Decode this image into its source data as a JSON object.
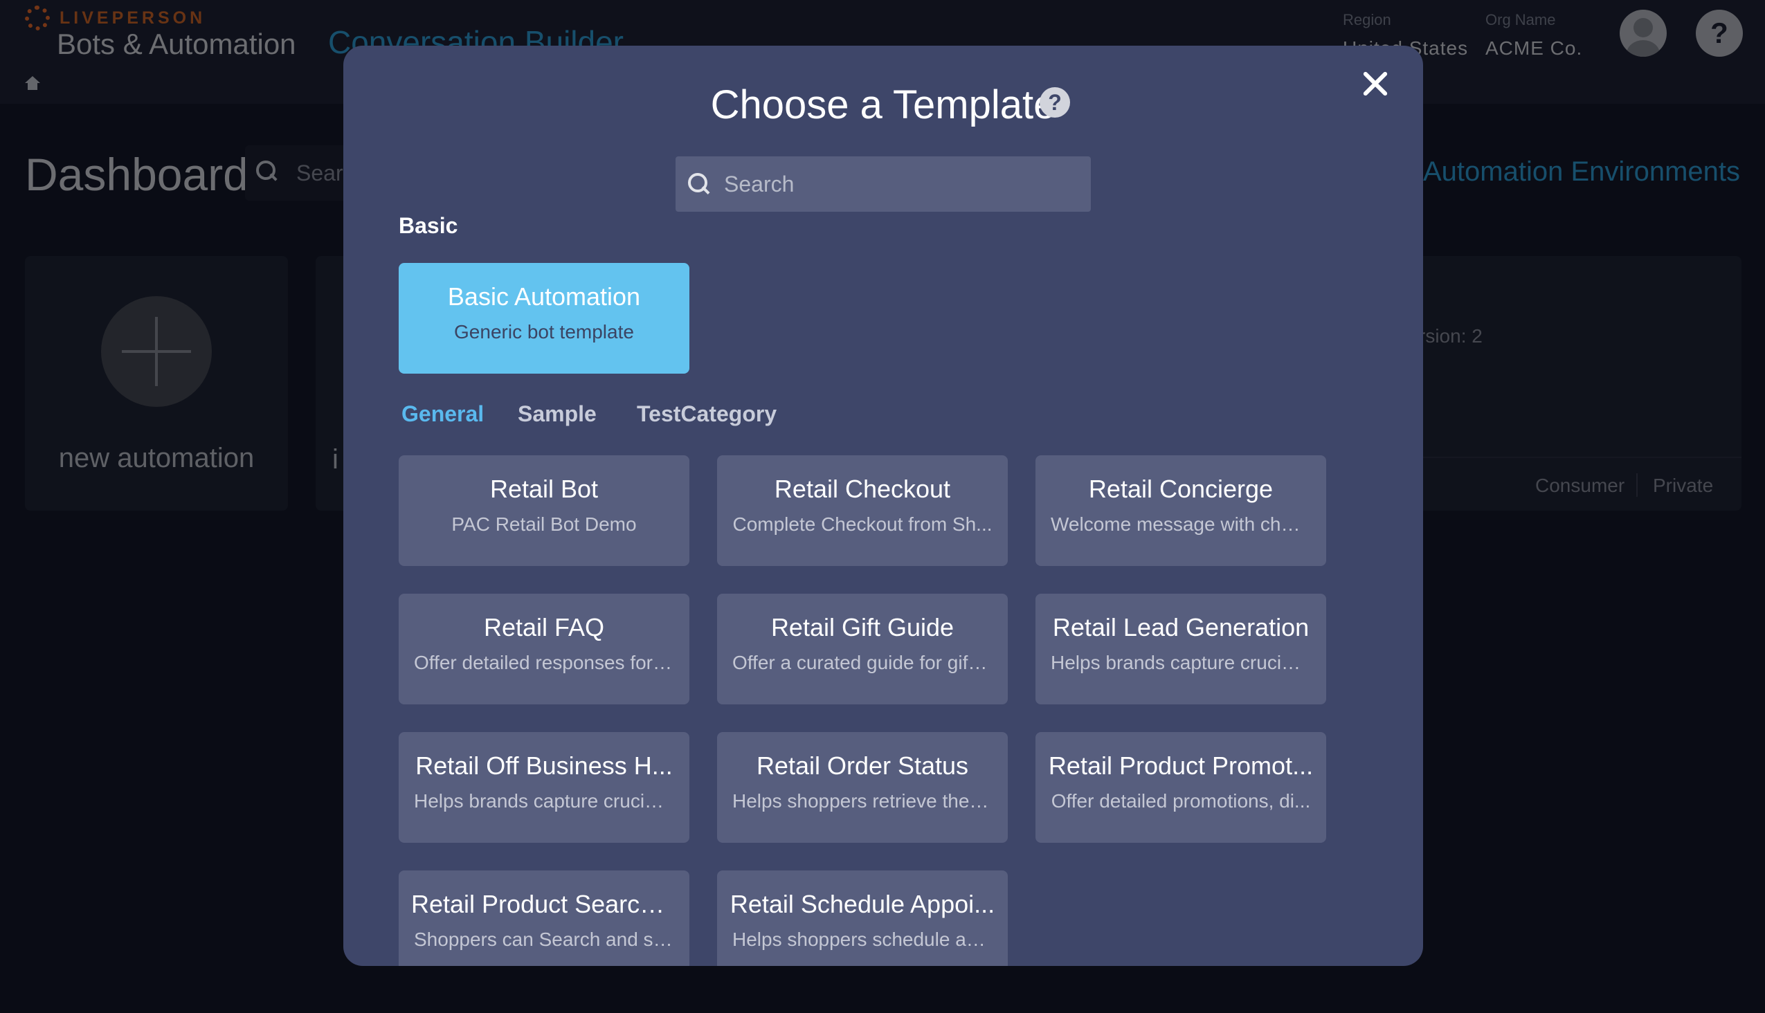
{
  "header": {
    "brand": "LIVEPERSON",
    "app_title": "Bots & Automation",
    "sub_title": "Conversation Builder",
    "region_label": "Region",
    "region_value": "United States",
    "org_label": "Org Name",
    "org_value": "ACME Co.",
    "help_glyph": "?",
    "icons": {
      "home": "home-icon",
      "avatar": "user-avatar-icon",
      "help": "help-icon"
    }
  },
  "dashboard": {
    "title": "Dashboard",
    "search_placeholder": "Search",
    "environments_link": "Automation Environments",
    "new_automation_label": "new automation",
    "card2_text": "i",
    "card3_version": "rsion: 2",
    "card3_tags": [
      "Consumer",
      "Private"
    ]
  },
  "modal": {
    "title": "Choose a Template",
    "help_glyph": "?",
    "search_placeholder": "Search",
    "basic_section_label": "Basic",
    "basic_template": {
      "name": "Basic Automation",
      "description": "Generic bot template"
    },
    "tabs": [
      {
        "label": "General",
        "active": true
      },
      {
        "label": "Sample",
        "active": false
      },
      {
        "label": "TestCategory",
        "active": false
      }
    ],
    "templates": [
      {
        "name": "Retail Bot",
        "description": "PAC Retail Bot Demo"
      },
      {
        "name": "Retail Checkout",
        "description": "Complete Checkout from Sh..."
      },
      {
        "name": "Retail Concierge",
        "description": "Welcome message with choi..."
      },
      {
        "name": "Retail FAQ",
        "description": "Offer detailed responses for ..."
      },
      {
        "name": "Retail Gift Guide",
        "description": "Offer a curated guide for gift ..."
      },
      {
        "name": "Retail Lead Generation",
        "description": "Helps brands capture crucial..."
      },
      {
        "name": "Retail Off Business H...",
        "description": "Helps brands capture crucial..."
      },
      {
        "name": "Retail Order Status",
        "description": "Helps shoppers retrieve the l..."
      },
      {
        "name": "Retail Product Promot...",
        "description": "Offer detailed promotions, di..."
      },
      {
        "name": "Retail Product Search ...",
        "description": "Shoppers can Search and sh..."
      },
      {
        "name": "Retail Schedule Appoi...",
        "description": "Helps shoppers schedule ap..."
      }
    ]
  },
  "colors": {
    "modal_bg": "#3e4669",
    "tile_bg": "#575e7e",
    "basic_tile_bg": "#63c3ef",
    "active_tab": "#5ab9ee",
    "brand_orange": "#e86a2c",
    "link_blue": "#2f9fd8"
  }
}
